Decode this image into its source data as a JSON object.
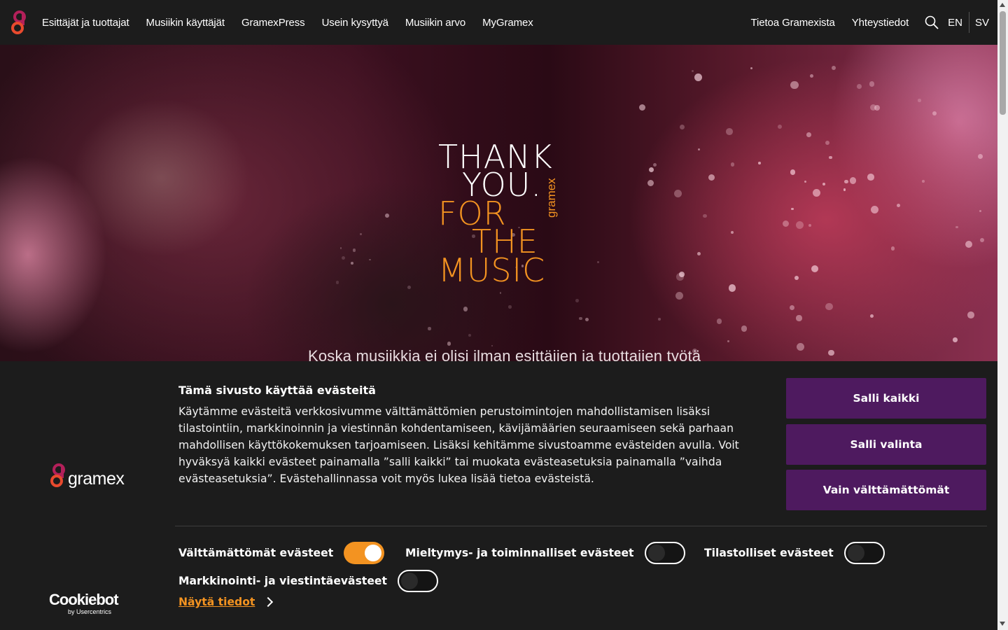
{
  "nav": {
    "left_items": [
      {
        "label": "Esittäjät ja tuottajat"
      },
      {
        "label": "Musiikin käyttäjät"
      },
      {
        "label": "GramexPress"
      },
      {
        "label": "Usein kysyttyä"
      },
      {
        "label": "Musiikin arvo"
      },
      {
        "label": "MyGramex"
      }
    ],
    "right_items": [
      {
        "label": "Tietoa Gramexista"
      },
      {
        "label": "Yhteystiedot"
      }
    ],
    "search_icon": "search-icon",
    "languages": [
      "EN",
      "SV"
    ]
  },
  "hero": {
    "title_lines": [
      {
        "text": "THANK",
        "color": "#ffffff"
      },
      {
        "text": "YOU.",
        "color": "#ffffff"
      },
      {
        "text": "FOR",
        "color": "#f39321"
      },
      {
        "text": "THE",
        "color": "#f39321"
      },
      {
        "text": "MUSIC",
        "color": "#f39321"
      }
    ],
    "brand_vertical": "gramex",
    "subtitle": "Koska musiikkia ei olisi ilman esittäjien ja tuottajien työtä"
  },
  "cookie_banner": {
    "brand_word": "gramex",
    "title": "Tämä sivusto käyttää evästeitä",
    "body": "Käytämme evästeitä verkkosivumme välttämättömien perustoimintojen mahdollistamisen lisäksi tilastointiin, markkinoinnin ja viestinnän kohdentamiseen, kävijämäärien seuraamiseen sekä parhaan mahdollisen käyttökokemuksen tarjoamiseen. Lisäksi kehitämme sivustoamme evästeiden avulla. Voit hyväksyä kaikki evästeet painamalla ”salli kaikki” tai muokata evästeasetuksia painamalla ”vaihda evästeasetuksia”. Evästehallinnassa voit myös lukea lisää tietoa evästeistä.",
    "buttons": {
      "allow_all": "Salli kaikki",
      "allow_selection": "Salli valinta",
      "necessary_only": "Vain välttämättömät"
    },
    "toggles": [
      {
        "label": "Välttämättömät evästeet",
        "checked": true
      },
      {
        "label": "Mieltymys- ja toiminnalliset evästeet",
        "checked": false
      },
      {
        "label": "Tilastolliset evästeet",
        "checked": false
      },
      {
        "label": "Markkinointi- ja viestintäevästeet",
        "checked": false
      }
    ],
    "show_details": "Näytä tiedot",
    "cookiebot": {
      "name": "Cookiebot",
      "by": "by Usercentrics"
    }
  },
  "colors": {
    "accent_orange": "#f39321",
    "button_purple": "#4e1a5f",
    "background": "#1c1c1c"
  }
}
